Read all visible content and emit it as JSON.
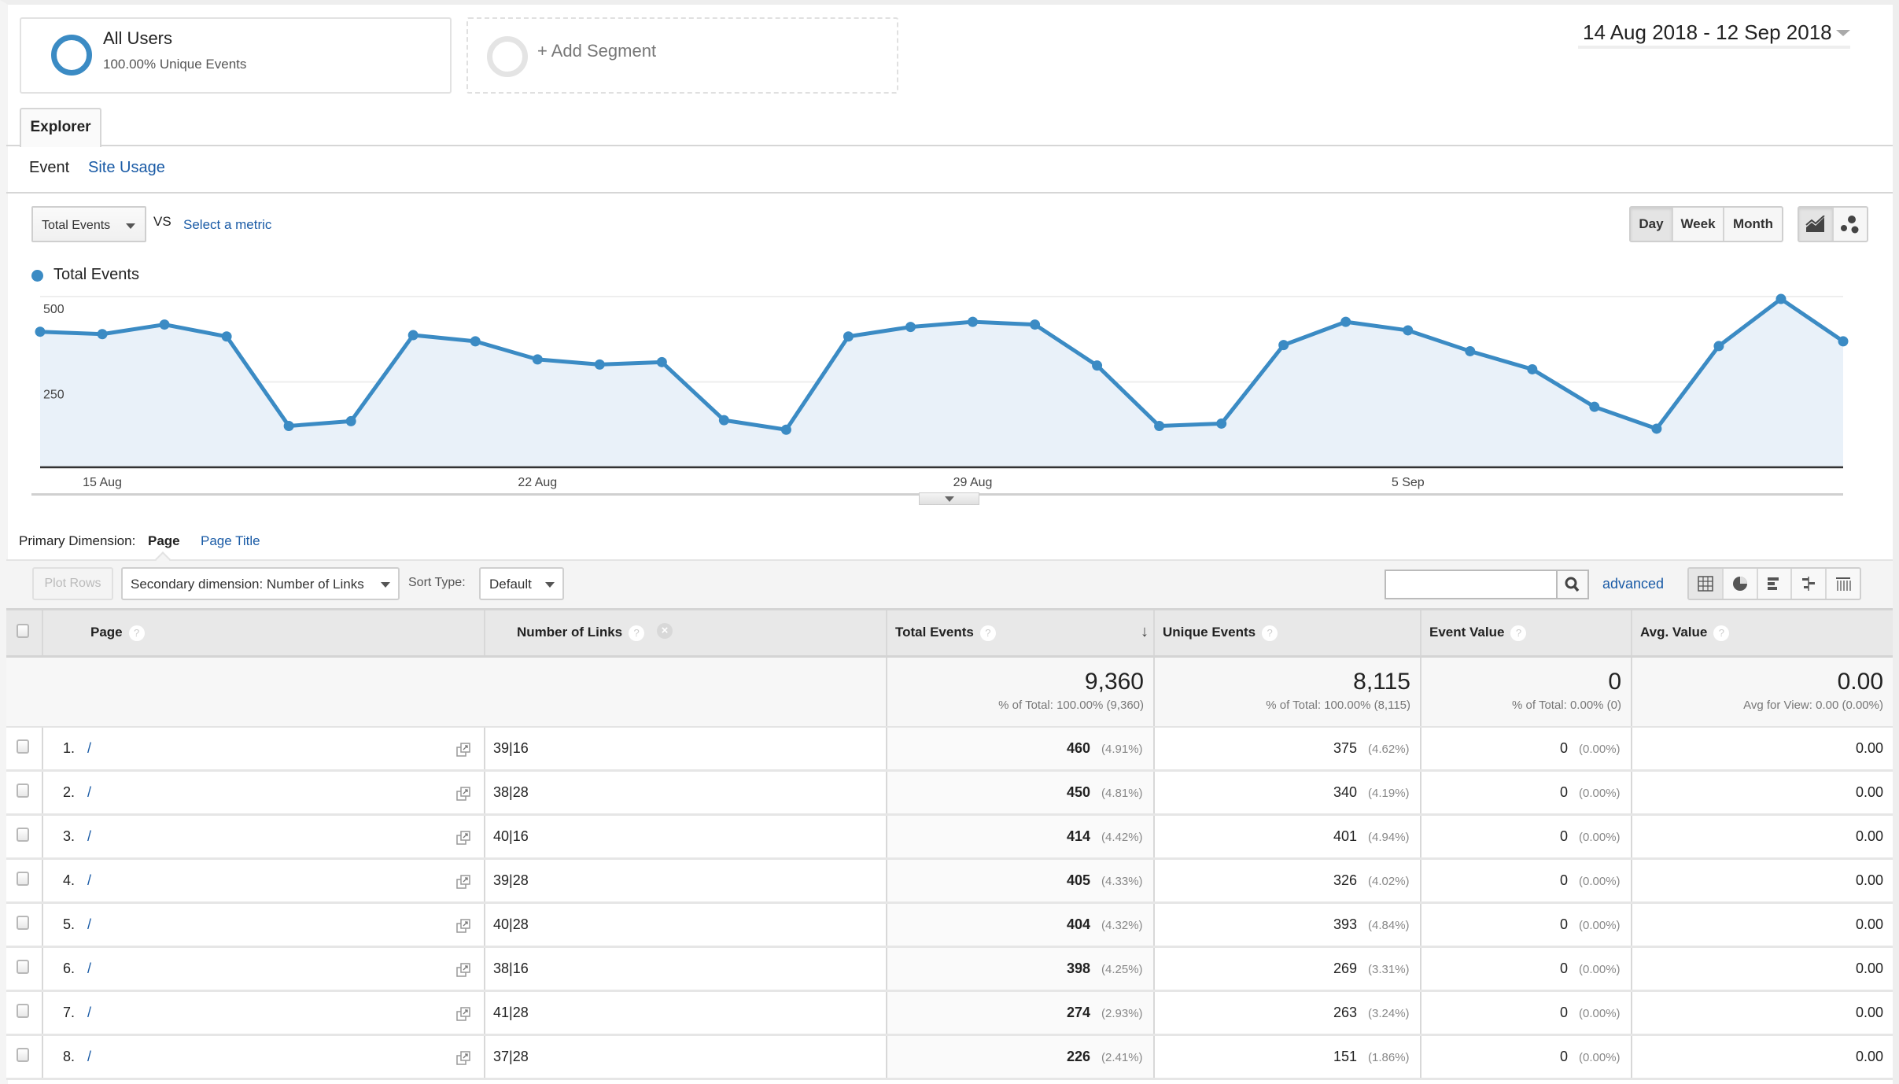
{
  "segments": [
    {
      "title": "All Users",
      "subtitle": "100.00% Unique Events",
      "ring_color": "#3b8bc4"
    },
    {
      "title": "+ Add Segment"
    }
  ],
  "date_range": "14 Aug 2018 - 12 Sep 2018",
  "tabs": {
    "explorer": "Explorer"
  },
  "subtabs": {
    "event": "Event",
    "site_usage": "Site Usage"
  },
  "metric_select": {
    "value": "Total Events",
    "vs": "VS",
    "select_metric": "Select a metric"
  },
  "granularity": {
    "day": "Day",
    "week": "Week",
    "month": "Month",
    "selected": "Day"
  },
  "chart_type_icons": [
    "line-chart-icon",
    "motion-chart-icon"
  ],
  "chart_data": {
    "type": "area",
    "title": "",
    "legend": [
      "Total Events"
    ],
    "legend_position": "top-left",
    "series_color": "#3b8bc4",
    "x": [
      "14 Aug",
      "15 Aug",
      "16 Aug",
      "17 Aug",
      "18 Aug",
      "19 Aug",
      "20 Aug",
      "21 Aug",
      "22 Aug",
      "23 Aug",
      "24 Aug",
      "25 Aug",
      "26 Aug",
      "27 Aug",
      "28 Aug",
      "29 Aug",
      "30 Aug",
      "31 Aug",
      "1 Sep",
      "2 Sep",
      "3 Sep",
      "4 Sep",
      "5 Sep",
      "6 Sep",
      "7 Sep",
      "8 Sep",
      "9 Sep",
      "10 Sep",
      "11 Sep",
      "12 Sep"
    ],
    "series": [
      {
        "name": "Total Events",
        "values": [
          397,
          390,
          418,
          383,
          121,
          135,
          387,
          369,
          316,
          301,
          308,
          138,
          110,
          383,
          411,
          426,
          418,
          298,
          121,
          128,
          358,
          426,
          401,
          340,
          287,
          177,
          113,
          355,
          493,
          369
        ]
      }
    ],
    "x_ticks": [
      "15 Aug",
      "22 Aug",
      "29 Aug",
      "5 Sep"
    ],
    "y_ticks": [
      "500",
      "250"
    ],
    "ylim": [
      0,
      500
    ],
    "grid": true
  },
  "primary_dimension": {
    "label": "Primary Dimension:",
    "active": "Page",
    "other": "Page Title"
  },
  "toolbar": {
    "plot_rows": "Plot Rows",
    "secondary_dimension": "Secondary dimension: Number of Links",
    "sort_type_label": "Sort Type:",
    "sort_type_value": "Default",
    "search_value": "",
    "advanced": "advanced"
  },
  "table": {
    "headers": {
      "page": "Page",
      "links": "Number of Links",
      "total_events": "Total Events",
      "unique_events": "Unique Events",
      "event_value": "Event Value",
      "avg_value": "Avg. Value"
    },
    "totals": {
      "total_events": "9,360",
      "total_events_sub": "% of Total: 100.00% (9,360)",
      "unique_events": "8,115",
      "unique_events_sub": "% of Total: 100.00% (8,115)",
      "event_value": "0",
      "event_value_sub": "% of Total: 0.00% (0)",
      "avg_value": "0.00",
      "avg_value_sub": "Avg for View: 0.00 (0.00%)"
    },
    "rows": [
      {
        "rank": "1.",
        "page": "/",
        "links": "39|16",
        "te": "460",
        "te_pct": "(4.91%)",
        "ue": "375",
        "ue_pct": "(4.62%)",
        "ev": "0",
        "ev_pct": "(0.00%)",
        "avg": "0.00"
      },
      {
        "rank": "2.",
        "page": "/",
        "links": "38|28",
        "te": "450",
        "te_pct": "(4.81%)",
        "ue": "340",
        "ue_pct": "(4.19%)",
        "ev": "0",
        "ev_pct": "(0.00%)",
        "avg": "0.00"
      },
      {
        "rank": "3.",
        "page": "/",
        "links": "40|16",
        "te": "414",
        "te_pct": "(4.42%)",
        "ue": "401",
        "ue_pct": "(4.94%)",
        "ev": "0",
        "ev_pct": "(0.00%)",
        "avg": "0.00"
      },
      {
        "rank": "4.",
        "page": "/",
        "links": "39|28",
        "te": "405",
        "te_pct": "(4.33%)",
        "ue": "326",
        "ue_pct": "(4.02%)",
        "ev": "0",
        "ev_pct": "(0.00%)",
        "avg": "0.00"
      },
      {
        "rank": "5.",
        "page": "/",
        "links": "40|28",
        "te": "404",
        "te_pct": "(4.32%)",
        "ue": "393",
        "ue_pct": "(4.84%)",
        "ev": "0",
        "ev_pct": "(0.00%)",
        "avg": "0.00"
      },
      {
        "rank": "6.",
        "page": "/",
        "links": "38|16",
        "te": "398",
        "te_pct": "(4.25%)",
        "ue": "269",
        "ue_pct": "(3.31%)",
        "ev": "0",
        "ev_pct": "(0.00%)",
        "avg": "0.00"
      },
      {
        "rank": "7.",
        "page": "/",
        "links": "41|28",
        "te": "274",
        "te_pct": "(2.93%)",
        "ue": "263",
        "ue_pct": "(3.24%)",
        "ev": "0",
        "ev_pct": "(0.00%)",
        "avg": "0.00"
      },
      {
        "rank": "8.",
        "page": "/",
        "links": "37|28",
        "te": "226",
        "te_pct": "(2.41%)",
        "ue": "151",
        "ue_pct": "(1.86%)",
        "ev": "0",
        "ev_pct": "(0.00%)",
        "avg": "0.00"
      }
    ]
  }
}
